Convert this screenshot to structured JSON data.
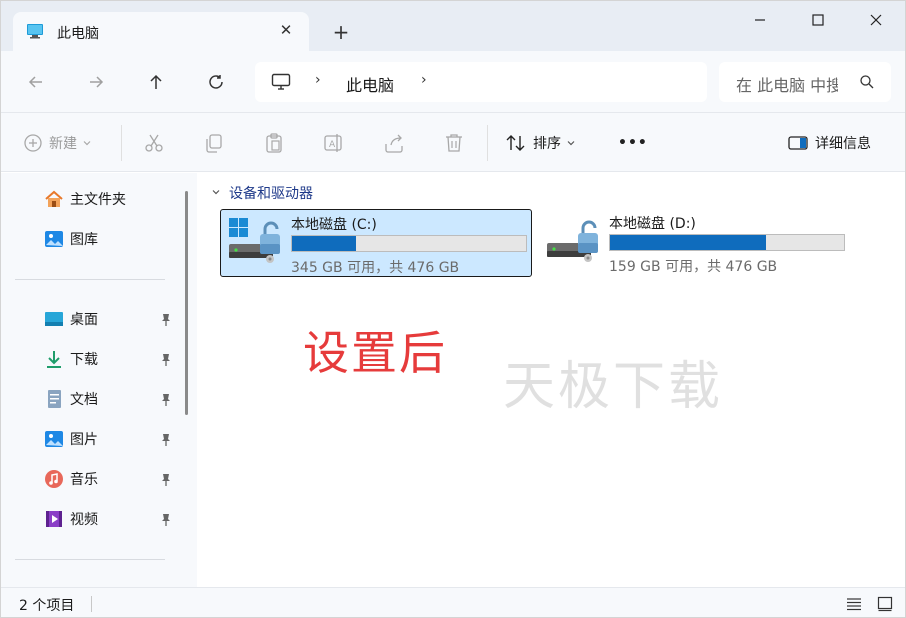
{
  "tab": {
    "title": "此电脑",
    "close_glyph": "✕",
    "new_tab_glyph": "+",
    "icon": "computer-icon"
  },
  "window_controls": {
    "minimize": "minimize-icon",
    "maximize": "maximize-icon",
    "close": "close-icon"
  },
  "nav": {
    "back": "arrow-left-icon",
    "forward": "arrow-right-icon",
    "up": "arrow-up-icon",
    "refresh": "refresh-icon"
  },
  "address": {
    "separator": "›",
    "path": "此电脑"
  },
  "search": {
    "placeholder": "在 此电脑 中搜索"
  },
  "toolbar": {
    "new_label": "新建",
    "sort_label": "排序",
    "more_label": "•••",
    "details_label": "详细信息"
  },
  "sidebar": {
    "quick": [
      {
        "label": "主文件夹",
        "icon": "home-icon"
      },
      {
        "label": "图库",
        "icon": "gallery-icon"
      }
    ],
    "pinned": [
      {
        "label": "桌面",
        "icon": "desktop-icon"
      },
      {
        "label": "下载",
        "icon": "download-icon"
      },
      {
        "label": "文档",
        "icon": "document-icon"
      },
      {
        "label": "图片",
        "icon": "pictures-icon"
      },
      {
        "label": "音乐",
        "icon": "music-icon"
      },
      {
        "label": "视频",
        "icon": "video-icon"
      }
    ]
  },
  "main": {
    "group_title": "设备和驱动器",
    "drives": [
      {
        "name": "本地磁盘 (C:)",
        "info": "345 GB 可用，共 476 GB",
        "used_fraction": 0.275,
        "selected": true
      },
      {
        "name": "本地磁盘 (D:)",
        "info": "159 GB 可用，共 476 GB",
        "used_fraction": 0.666,
        "selected": false
      }
    ]
  },
  "overlay_text": "设置后",
  "watermark": "天极下载",
  "status": {
    "count": "2 个项目"
  },
  "colors": {
    "accent": "#0f6cbd",
    "selection": "#cce8ff",
    "overlay_red": "#e63b3b"
  }
}
